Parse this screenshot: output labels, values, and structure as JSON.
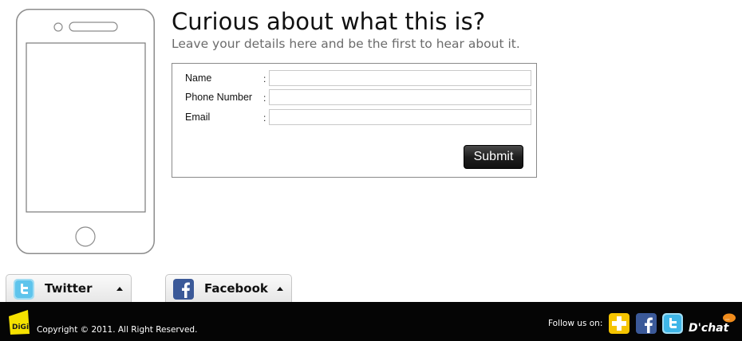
{
  "heading": {
    "title": "Curious about what this is?",
    "subtitle": "Leave your details here and be the first to hear about it."
  },
  "form": {
    "fields": [
      {
        "label": "Name",
        "colon": ":",
        "value": ""
      },
      {
        "label": "Phone Number",
        "colon": ":",
        "value": ""
      },
      {
        "label": "Email",
        "colon": ":",
        "value": ""
      }
    ],
    "submit_label": "Submit"
  },
  "tabs": [
    {
      "label": "Twitter",
      "icon": "twitter-icon"
    },
    {
      "label": "Facebook",
      "icon": "facebook-icon"
    }
  ],
  "footer": {
    "logo_text": "DiGi",
    "copyright": "Copyright © 2011. All Right Reserved.",
    "follow_label": "Follow us on:",
    "social": [
      {
        "name": "plus-icon",
        "color": "#f5c400"
      },
      {
        "name": "facebook-icon",
        "color": "#3b5998"
      },
      {
        "name": "twitter-icon",
        "color": "#3fb6e8"
      },
      {
        "name": "dchat-icon",
        "label": "D'chat",
        "color": "#f08c1c"
      }
    ]
  },
  "colors": {
    "footer_bg": "#050505",
    "digi_yellow": "#f5e100",
    "submit_bg": "#1e1e1e"
  }
}
